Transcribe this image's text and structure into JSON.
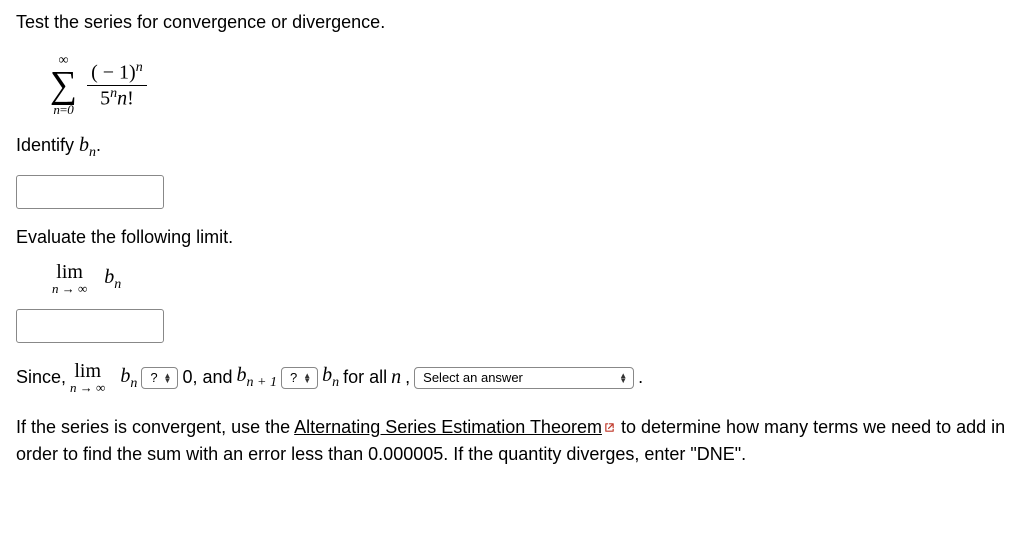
{
  "intro": "Test the series for convergence or divergence.",
  "series": {
    "upper": "∞",
    "lower_var": "n",
    "lower_eq": "=",
    "lower_val": "0",
    "numerator": "( − 1)",
    "num_exp": "n",
    "denom_base": "5",
    "denom_exp": "n",
    "denom_var": "n",
    "denom_fact": "!"
  },
  "identify_label": "Identify ",
  "identify_var": "b",
  "identify_sub": "n",
  "identify_period": ".",
  "evaluate_label": "Evaluate the following limit.",
  "limit": {
    "lim": "lim",
    "below_var": "n",
    "below_arrow": " → ∞",
    "rhs_var": "b",
    "rhs_sub": "n"
  },
  "since": {
    "since": "Since, ",
    "zero_text": " 0, and ",
    "bnp1_b": "b",
    "bnp1_sub": "n + 1",
    "bn_b": "b",
    "bn_sub": "n",
    "forall": " for all ",
    "n_var": "n",
    "comma": ", ",
    "period": " ."
  },
  "dropdown_q": "?",
  "dropdown_select": "Select an answer",
  "final": {
    "part1": "If the series is convergent, use the ",
    "link": "Alternating Series Estimation Theorem",
    "part2": " to determine how many terms we need to add in order to find the sum with an error less than 0.000005. If the quantity diverges, enter \"DNE\"."
  }
}
